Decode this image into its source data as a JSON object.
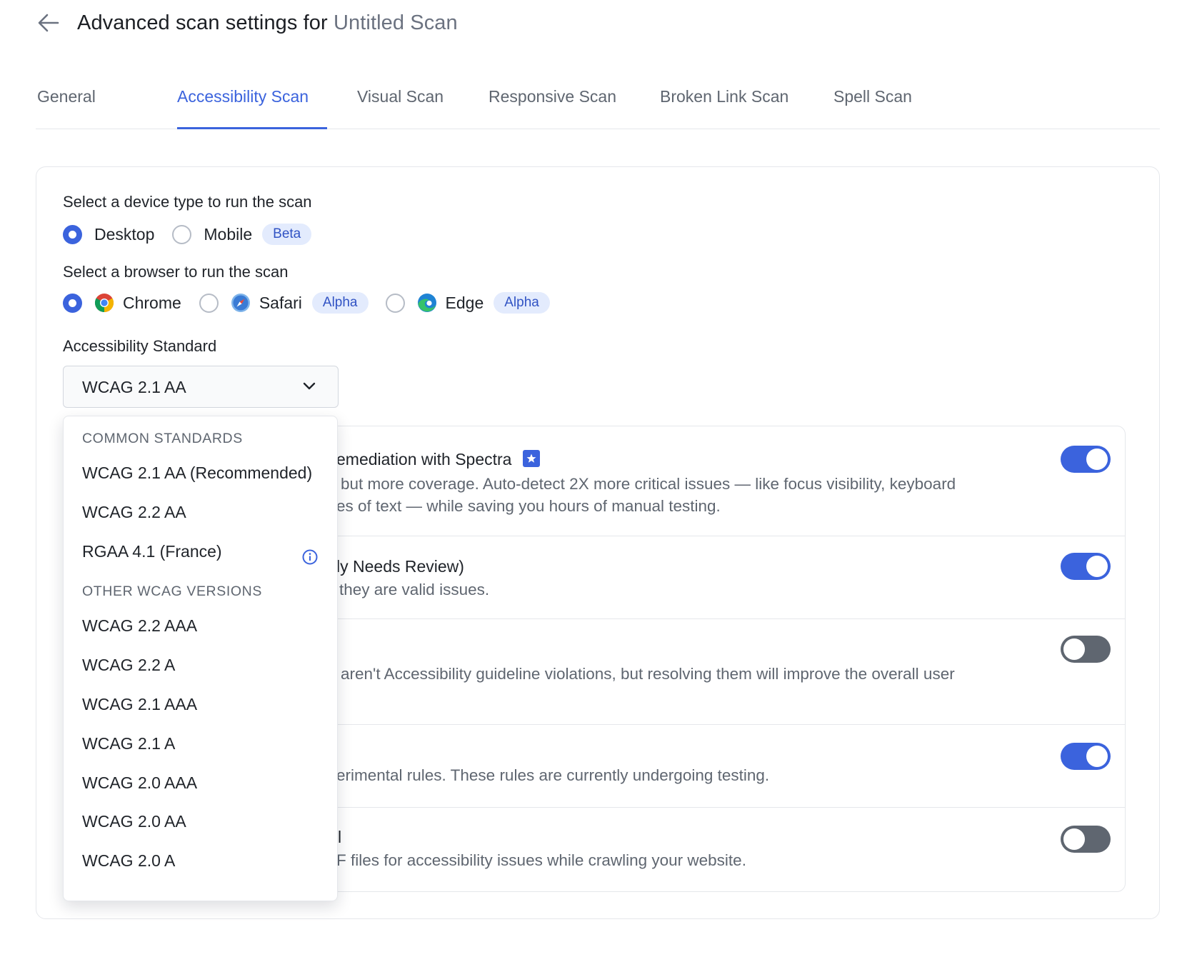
{
  "header": {
    "title_prefix": "Advanced scan settings for ",
    "scan_name": "Untitled Scan"
  },
  "tabs": [
    {
      "label": "General"
    },
    {
      "label": "Accessibility Scan",
      "active": true
    },
    {
      "label": "Visual Scan"
    },
    {
      "label": "Responsive Scan"
    },
    {
      "label": "Broken Link Scan"
    },
    {
      "label": "Spell Scan"
    }
  ],
  "device": {
    "label": "Select a device type to run the scan",
    "options": [
      {
        "label": "Desktop",
        "selected": true
      },
      {
        "label": "Mobile",
        "badge": "Beta"
      }
    ]
  },
  "browser": {
    "label": "Select a browser to run the scan",
    "options": [
      {
        "label": "Chrome",
        "icon": "chrome-icon",
        "selected": true
      },
      {
        "label": "Safari",
        "icon": "safari-icon",
        "badge": "Alpha"
      },
      {
        "label": "Edge",
        "icon": "edge-icon",
        "badge": "Alpha"
      }
    ]
  },
  "standard": {
    "label": "Accessibility Standard",
    "value": "WCAG 2.1 AA"
  },
  "dropdown": {
    "groups": [
      {
        "label": "COMMON STANDARDS",
        "items": [
          "WCAG 2.1 AA (Recommended)",
          "WCAG 2.2 AA",
          "RGAA 4.1 (France)"
        ]
      },
      {
        "label": "OTHER WCAG VERSIONS",
        "items": [
          "WCAG 2.2 AAA",
          "WCAG 2.2 A",
          "WCAG 2.1 AAA",
          "WCAG 2.1 A",
          "WCAG 2.0 AAA",
          "WCAG 2.0 AA",
          "WCAG 2.0 A"
        ]
      }
    ]
  },
  "settings": [
    {
      "title": "emediation with Spectra",
      "desc_lines": [
        "but more coverage. Auto-detect 2X more critical issues — like focus visibility, keyboard",
        "es of text — while saving you hours of manual testing."
      ],
      "on": true
    },
    {
      "title": "ly Needs Review)",
      "desc_lines": [
        "they are valid issues."
      ],
      "on": true
    },
    {
      "title": "",
      "desc_lines": [
        "aren't Accessibility guideline violations, but resolving them will improve the overall user"
      ],
      "on": false
    },
    {
      "title": "",
      "desc_lines": [
        "erimental rules. These rules are currently undergoing testing."
      ],
      "on": true
    },
    {
      "title": "l",
      "desc_lines": [
        "F files for accessibility issues while crawling your website."
      ],
      "on": false
    }
  ],
  "colors": {
    "accent": "#3b63dd",
    "badge_bg": "#e3ebfd",
    "toggle_off": "#5f6670"
  }
}
